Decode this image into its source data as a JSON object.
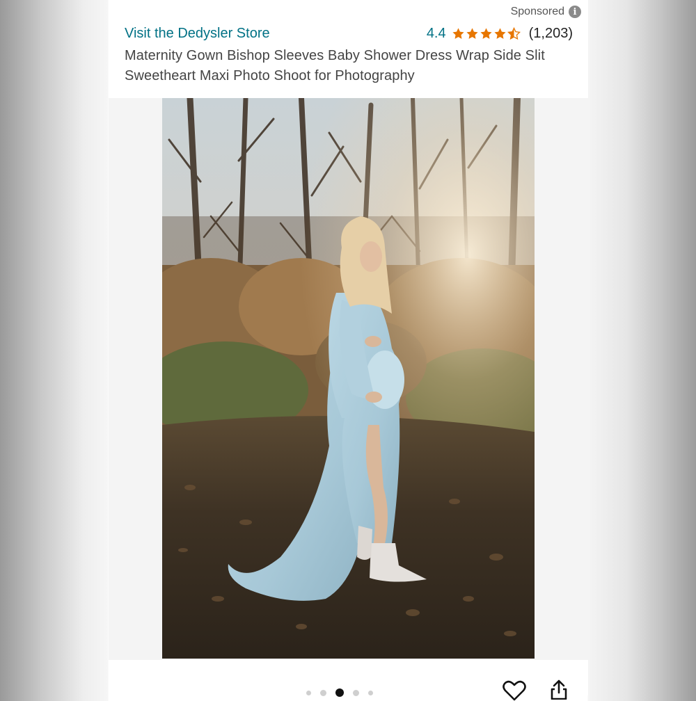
{
  "header": {
    "sponsored_label": "Sponsored",
    "info_icon_glyph": "i",
    "store_link": "Visit the Dedysler Store",
    "rating_value": "4.4",
    "rating_stars": 4.4,
    "rating_count": "(1,203)",
    "product_title": "Maternity Gown Bishop Sleeves Baby Shower Dress Wrap Side Slit Sweetheart Maxi Photo Shoot for Photography"
  },
  "carousel": {
    "image_count": 5,
    "active_index": 2
  },
  "actions": {
    "favorite_icon": "heart-icon",
    "share_icon": "share-icon"
  },
  "colors": {
    "link": "#007185",
    "star": "#E77600",
    "text": "#444444"
  }
}
